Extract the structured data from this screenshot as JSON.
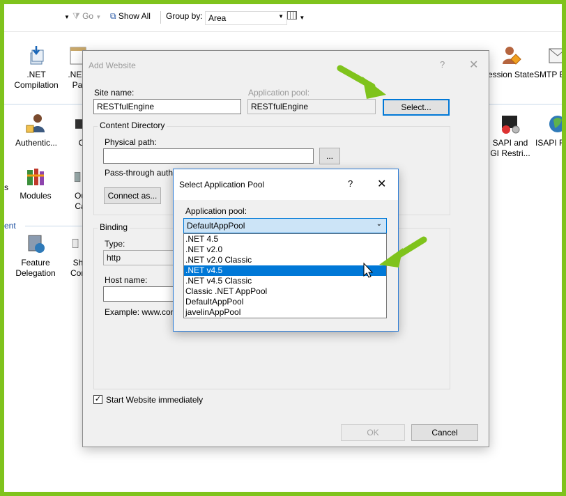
{
  "toolbar": {
    "go_label": "Go",
    "show_all_label": "Show All",
    "group_by_label": "Group by:",
    "group_by_value": "Area"
  },
  "features": [
    {
      "label": ".NET\nCompilation",
      "icon": "net-compilation-icon"
    },
    {
      "label": ".NET\nPa",
      "icon": "net-pages-icon"
    },
    {
      "label": "ession State",
      "icon": "session-state-icon"
    },
    {
      "label": "SMTP E",
      "icon": "smtp-email-icon"
    },
    {
      "label": "Authentic...",
      "icon": "authentication-icon"
    },
    {
      "label": "C",
      "icon": "compression-icon"
    },
    {
      "label": "SAPI and\nGI Restri...",
      "icon": "isapi-cgi-icon"
    },
    {
      "label": "ISAPI F",
      "icon": "isapi-filters-icon"
    },
    {
      "label": "Modules",
      "icon": "modules-icon"
    },
    {
      "label": "Ou\nCa",
      "icon": "output-caching-icon"
    },
    {
      "label": "Feature\nDelegation",
      "icon": "feature-delegation-icon"
    },
    {
      "label": "Sh\nCon",
      "icon": "shared-config-icon"
    },
    {
      "label": "s",
      "icon": ""
    }
  ],
  "section_label": "ent",
  "add_website": {
    "title": "Add Website",
    "help": "?",
    "close": "✕",
    "site_name_label": "Site name:",
    "site_name_value": "RESTfulEngine",
    "app_pool_label": "Application pool:",
    "app_pool_value": "RESTfulEngine",
    "select_button": "Select...",
    "content_directory_label": "Content Directory",
    "physical_path_label": "Physical path:",
    "physical_path_value": "",
    "browse_button": "...",
    "pass_through_label": "Pass-through authentication",
    "connect_as_button": "Connect as...",
    "binding_label": "Binding",
    "type_label": "Type:",
    "type_value": "http",
    "host_name_label": "Host name:",
    "example_label": "Example: www.con",
    "start_immediately_label": "Start Website immediately",
    "start_immediately_checked": true,
    "ok_button": "OK",
    "cancel_button": "Cancel"
  },
  "select_pool": {
    "title": "Select Application Pool",
    "help": "?",
    "close": "✕",
    "pool_label": "Application pool:",
    "selected_value": "DefaultAppPool",
    "options": [
      ".NET 4.5",
      ".NET v2.0",
      ".NET v2.0 Classic",
      ".NET v4.5",
      ".NET v4.5 Classic",
      "Classic .NET AppPool",
      "DefaultAppPool",
      "javelinAppPool"
    ],
    "highlighted_option": ".NET v4.5"
  },
  "colors": {
    "frame_border": "#7fc31c",
    "arrow": "#7fc31c",
    "selection": "#0078d7"
  }
}
